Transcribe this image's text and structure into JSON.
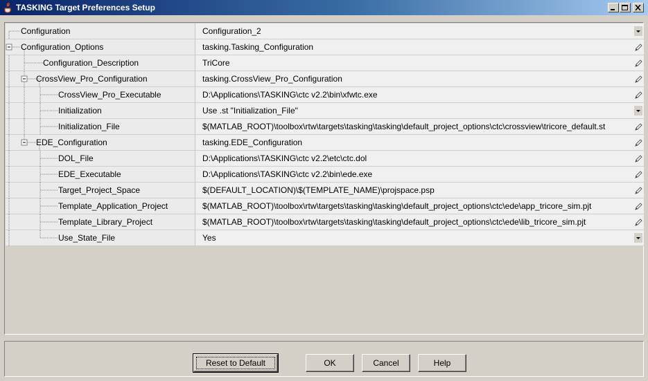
{
  "window": {
    "title": "TASKING Target Preferences Setup",
    "icon": "java-cup-icon"
  },
  "rows": [
    {
      "name": "Configuration",
      "value": "Configuration_2",
      "control": "dropdown",
      "level": 0
    },
    {
      "name": "Configuration_Options",
      "value": "tasking.Tasking_Configuration",
      "control": "edit",
      "level": 0,
      "expandable": "minus"
    },
    {
      "name": "Configuration_Description",
      "value": "TriCore",
      "control": "edit",
      "level": 1
    },
    {
      "name": "CrossView_Pro_Configuration",
      "value": "tasking.CrossView_Pro_Configuration",
      "control": "edit",
      "level": 1,
      "expandable": "minus"
    },
    {
      "name": "CrossView_Pro_Executable",
      "value": "D:\\Applications\\TASKING\\ctc v2.2\\bin\\xfwtc.exe",
      "control": "edit",
      "level": 2
    },
    {
      "name": "Initialization",
      "value": "Use .st \"Initialization_File\"",
      "control": "dropdown",
      "level": 2
    },
    {
      "name": "Initialization_File",
      "value": "$(MATLAB_ROOT)\\toolbox\\rtw\\targets\\tasking\\tasking\\default_project_options\\ctc\\crossview\\tricore_default.st",
      "control": "edit",
      "level": 2
    },
    {
      "name": "EDE_Configuration",
      "value": "tasking.EDE_Configuration",
      "control": "edit",
      "level": 1,
      "expandable": "minus"
    },
    {
      "name": "DOL_File",
      "value": "D:\\Applications\\TASKING\\ctc v2.2\\etc\\ctc.dol",
      "control": "edit",
      "level": 2
    },
    {
      "name": "EDE_Executable",
      "value": "D:\\Applications\\TASKING\\ctc v2.2\\bin\\ede.exe",
      "control": "edit",
      "level": 2
    },
    {
      "name": "Target_Project_Space",
      "value": "$(DEFAULT_LOCATION)\\$(TEMPLATE_NAME)\\projspace.psp",
      "control": "edit",
      "level": 2
    },
    {
      "name": "Template_Application_Project",
      "value": "$(MATLAB_ROOT)\\toolbox\\rtw\\targets\\tasking\\tasking\\default_project_options\\ctc\\ede\\app_tricore_sim.pjt",
      "control": "edit",
      "level": 2
    },
    {
      "name": "Template_Library_Project",
      "value": "$(MATLAB_ROOT)\\toolbox\\rtw\\targets\\tasking\\tasking\\default_project_options\\ctc\\ede\\lib_tricore_sim.pjt",
      "control": "edit",
      "level": 2
    },
    {
      "name": "Use_State_File",
      "value": "Yes",
      "control": "dropdown",
      "level": 2,
      "last": true
    }
  ],
  "buttons": {
    "reset": "Reset to Default",
    "ok": "OK",
    "cancel": "Cancel",
    "help": "Help"
  }
}
